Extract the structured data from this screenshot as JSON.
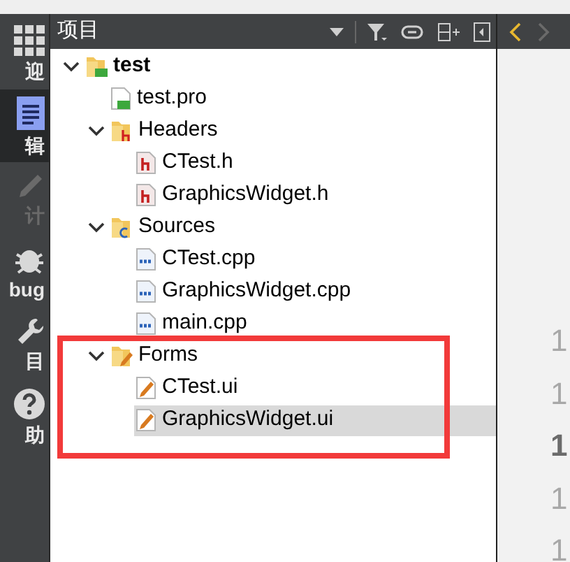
{
  "sidebar": {
    "modes": [
      {
        "kind": "welcome",
        "label": "迎",
        "selected": false,
        "disabled": false
      },
      {
        "kind": "edit",
        "label": "辑",
        "selected": true,
        "disabled": false
      },
      {
        "kind": "design",
        "label": "计",
        "selected": false,
        "disabled": true
      },
      {
        "kind": "debug",
        "label": "bug",
        "selected": false,
        "disabled": false
      },
      {
        "kind": "projects",
        "label": "目",
        "selected": false,
        "disabled": false
      },
      {
        "kind": "help",
        "label": "助",
        "selected": false,
        "disabled": false
      }
    ]
  },
  "panel": {
    "title": "项目"
  },
  "tree": [
    {
      "label": "test",
      "kind": "project",
      "expanded": true,
      "selected": false,
      "children": [
        {
          "label": "test.pro",
          "kind": "pro",
          "selected": false
        },
        {
          "label": "Headers",
          "kind": "headers",
          "expanded": true,
          "selected": false,
          "children": [
            {
              "label": "CTest.h",
              "kind": "h",
              "selected": false
            },
            {
              "label": "GraphicsWidget.h",
              "kind": "h",
              "selected": false
            }
          ]
        },
        {
          "label": "Sources",
          "kind": "sources",
          "expanded": true,
          "selected": false,
          "children": [
            {
              "label": "CTest.cpp",
              "kind": "cpp",
              "selected": false
            },
            {
              "label": "GraphicsWidget.cpp",
              "kind": "cpp",
              "selected": false
            },
            {
              "label": "main.cpp",
              "kind": "cpp",
              "selected": false
            }
          ]
        },
        {
          "label": "Forms",
          "kind": "forms",
          "expanded": true,
          "selected": false,
          "children": [
            {
              "label": "CTest.ui",
              "kind": "ui",
              "selected": false
            },
            {
              "label": "GraphicsWidget.ui",
              "kind": "ui",
              "selected": true
            }
          ]
        }
      ]
    }
  ],
  "editor": {
    "line_numbers": [
      {
        "text": "1",
        "current": false
      },
      {
        "text": "1",
        "current": false
      },
      {
        "text": "1",
        "current": true
      },
      {
        "text": "1",
        "current": false
      },
      {
        "text": "1",
        "current": false
      }
    ]
  }
}
